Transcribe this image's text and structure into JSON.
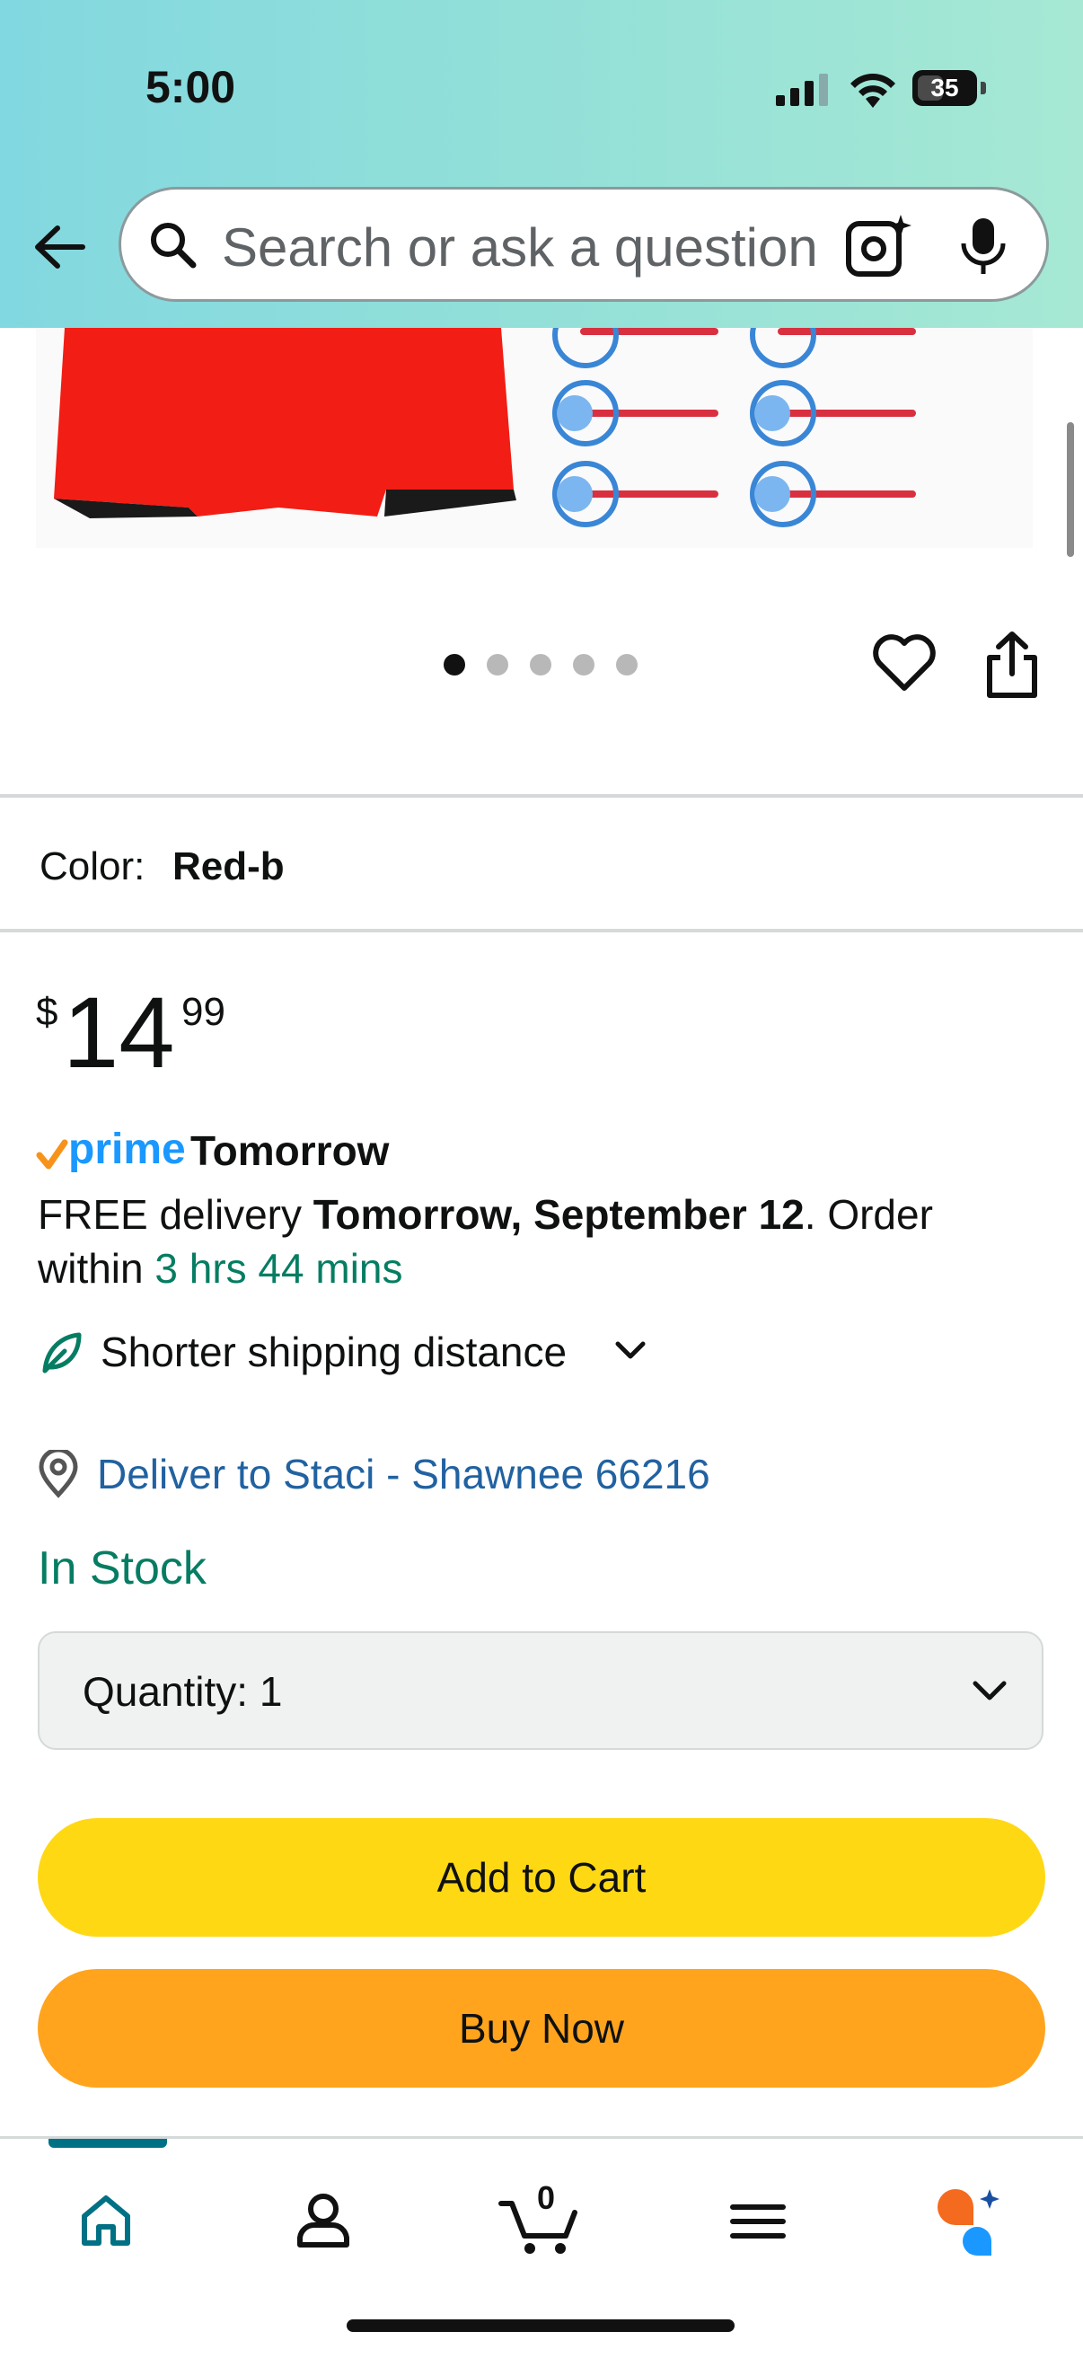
{
  "status_bar": {
    "time": "5:00",
    "battery": "35"
  },
  "search": {
    "placeholder": "Search or ask a question"
  },
  "gallery": {
    "page_count": 5,
    "active_index": 0
  },
  "product": {
    "color_label": "Color:",
    "color_value": "Red-b",
    "price": {
      "symbol": "$",
      "whole": "14",
      "fraction": "99"
    }
  },
  "delivery": {
    "prime_word": "prime",
    "prime_day": "Tomorrow",
    "free_delivery": "FREE delivery",
    "date": "Tomorrow, September 12",
    "order_text": ". Order within",
    "countdown": "3 hrs 44 mins",
    "shipping": "Shorter shipping distance",
    "deliver_to": "Deliver to Staci - Shawnee 66216",
    "stock": "In Stock"
  },
  "quantity": {
    "label": "Quantity:",
    "value": "1"
  },
  "actions": {
    "add_to_cart": "Add to Cart",
    "buy_now": "Buy Now"
  },
  "bottom_nav": {
    "cart_count": "0",
    "items": [
      "home-icon",
      "account-icon",
      "cart-icon",
      "menu-icon",
      "rufus-icon"
    ]
  },
  "colors": {
    "add_to_cart": "#ffd814",
    "buy_now": "#ffa41c",
    "link": "#2162a1",
    "green": "#067d62",
    "prime_blue": "#1a98ff"
  }
}
